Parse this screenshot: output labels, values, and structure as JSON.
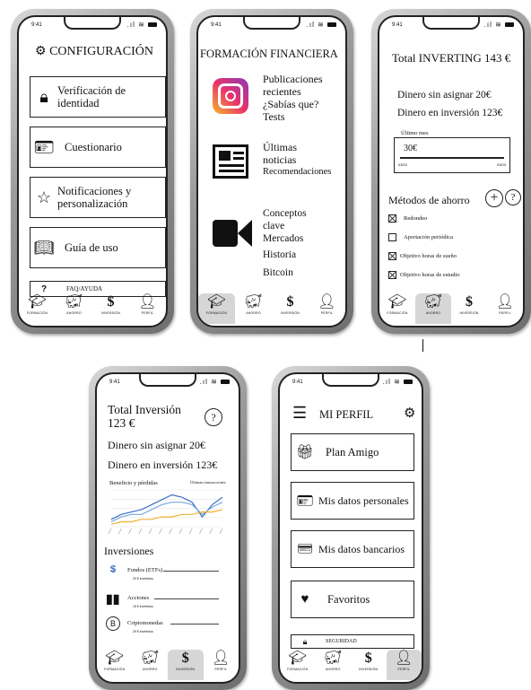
{
  "status": {
    "time": "9:41"
  },
  "tabs": [
    {
      "label": "FORMACIÓN",
      "icon": "graduation-cap-icon"
    },
    {
      "label": "AHORRO",
      "icon": "piggy-bank-icon"
    },
    {
      "label": "INVERSIÓN",
      "icon": "dollar-icon"
    },
    {
      "label": "PERFIL",
      "icon": "person-icon"
    }
  ],
  "config": {
    "title": "CONFIGURACIÓN",
    "items": [
      {
        "label": "Verificación de identidad",
        "icon": "lock-icon"
      },
      {
        "label": "Cuestionario",
        "icon": "id-card-icon"
      },
      {
        "label": "Notificaciones y personalización",
        "icon": "star-icon"
      },
      {
        "label": "Guía de uso",
        "icon": "book-icon"
      }
    ],
    "faq": "FAQ/AYUDA",
    "faq_icon": "?"
  },
  "formacion": {
    "title": "FORMACIÓN FINANCIERA",
    "sections": [
      {
        "icon": "instagram-icon",
        "lines": [
          "Publicaciones",
          "recientes",
          "¿Sabías que?",
          "Tests"
        ]
      },
      {
        "icon": "newspaper-icon",
        "lines": [
          "Últimas",
          "noticias",
          "Recomendaciones"
        ]
      },
      {
        "icon": "video-camera-icon",
        "lines": [
          "Conceptos",
          "clave",
          "Mercados",
          "Historia",
          "Bitcoin"
        ]
      }
    ]
  },
  "ahorro": {
    "title": "Total INVERTING 143 €",
    "sin_asignar": "Dinero sin asignar 20€",
    "en_inversion": "Dinero en inversión 123€",
    "period_label": "Último mes",
    "period_value": "30€",
    "slider_start": "03/02",
    "slider_end": "03/03",
    "metodos_title": "Métodos de ahorro",
    "metodos": [
      {
        "label": "Redondeo",
        "checked": true
      },
      {
        "label": "Aportación periódica",
        "checked": false
      },
      {
        "label": "Objetivo horas de sueño",
        "checked": true
      },
      {
        "label": "Objetivo horas de estudio",
        "checked": true
      }
    ]
  },
  "inversion": {
    "title_line1": "Total Inversión",
    "title_line2": "123 €",
    "sin_asignar": "Dinero sin asignar 20€",
    "en_inversion": "Dinero en inversión 123€",
    "chart_label": "Beneficio y pérdidas",
    "chart_link": "Últimas transacciones",
    "section_title": "Inversiones",
    "items": [
      {
        "label": "Fondos (ETFs)",
        "sub": "20 € invertidos",
        "icon": "etf-icon"
      },
      {
        "label": "Acciones",
        "sub": "15 € invertidos",
        "icon": "stocks-icon"
      },
      {
        "label": "Criptomonedas",
        "sub": "29 € invertidos",
        "icon": "bitcoin-icon"
      }
    ]
  },
  "perfil": {
    "title": "MI PERFIL",
    "items": [
      {
        "label": "Plan Amigo",
        "icon": "gift-icon"
      },
      {
        "label": "Mis datos personales",
        "icon": "id-card-icon"
      },
      {
        "label": "Mis datos bancarios",
        "icon": "credit-card-icon"
      },
      {
        "label": "Favoritos",
        "icon": "heart-icon"
      }
    ],
    "security": "SEGURIDAD"
  },
  "chart_data": {
    "type": "line",
    "series": [
      {
        "values": [
          3,
          5,
          6,
          7,
          9,
          11,
          13,
          12,
          10,
          4,
          9,
          12
        ]
      },
      {
        "values": [
          2,
          4,
          5,
          5,
          7,
          9,
          10,
          10,
          9,
          5,
          8,
          10
        ]
      },
      {
        "values": [
          1,
          2,
          2,
          3,
          3,
          4,
          4,
          5,
          5,
          6,
          6,
          7
        ]
      }
    ],
    "colors": [
      "#3a6fc4",
      "#7aa8e0",
      "#f0b030"
    ],
    "ylim": [
      0,
      15
    ]
  }
}
